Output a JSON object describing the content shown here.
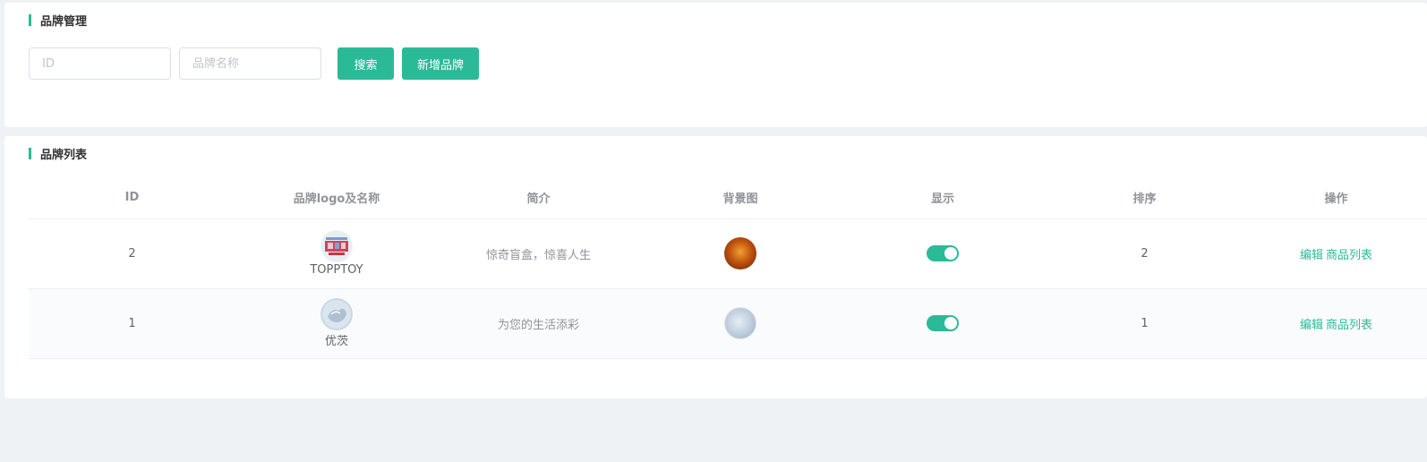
{
  "search_panel": {
    "title": "品牌管理",
    "id_placeholder": "ID",
    "name_placeholder": "品牌名称",
    "search_label": "搜索",
    "add_label": "新增品牌"
  },
  "list_panel": {
    "title": "品牌列表",
    "columns": [
      "ID",
      "品牌logo及名称",
      "简介",
      "背景图",
      "显示",
      "排序",
      "操作"
    ],
    "rows": [
      {
        "id": "2",
        "brand_name": "TOPPTOY",
        "intro": "惊奇盲盒，惊喜人生",
        "show": true,
        "sort": "2",
        "edit_label": "编辑",
        "products_label": "商品列表"
      },
      {
        "id": "1",
        "brand_name": "优茨",
        "intro": "为您的生活添彩",
        "show": true,
        "sort": "1",
        "edit_label": "编辑",
        "products_label": "商品列表"
      }
    ]
  },
  "colors": {
    "accent": "#2bba98",
    "background": "#eff2f5"
  }
}
